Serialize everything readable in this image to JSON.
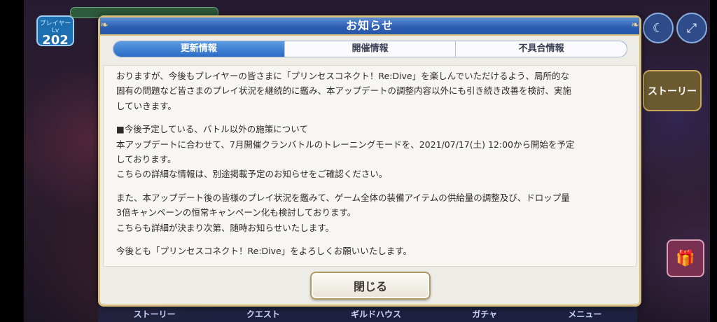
{
  "dialog": {
    "title": "お知らせ",
    "tabs": [
      {
        "label": "更新情報",
        "active": true
      },
      {
        "label": "開催情報",
        "active": false
      },
      {
        "label": "不具合情報",
        "active": false
      }
    ],
    "close_label": "閉じる",
    "paragraphs": [
      [
        "おりますが、今後もプレイヤーの皆さまに「プリンセスコネクト！Re:Dive」を楽しんでいただけるよう、局所的な",
        "固有の問題など皆さまのプレイ状況を継続的に鑑み、本アップデートの調整内容以外にも引き続き改善を検討、実施",
        "していきます。"
      ],
      [
        "■今後予定している、バトル以外の施策について",
        "本アップデートに合わせて、7月開催クランバトルのトレーニングモードを、2021/07/17(土) 12:00から開始を予定",
        "しております。",
        "こちらの詳細な情報は、別途掲載予定のお知らせをご確認ください。"
      ],
      [
        "また、本アップデート後の皆様のプレイ状況を鑑みて、ゲーム全体の装備アイテムの供給量の調整及び、ドロップ量",
        "3倍キャンペーンの恒常キャンペーン化も検討しております。",
        "こちらも詳細が決まり次第、随時お知らせいたします。"
      ],
      [
        "今後とも「プリンセスコネクト！Re:Dive」をよろしくお願いいたします。"
      ]
    ]
  },
  "background": {
    "player_level_label": "プレイヤーLv",
    "player_level": "202",
    "story_button": "ストーリー",
    "nav": [
      "ストーリー",
      "クエスト",
      "ギルドハウス",
      "ガチャ",
      "メニュー"
    ]
  },
  "colors": {
    "header_blue": "#2f5fb4",
    "active_tab": "#2c6cc6",
    "frame_gold": "#d8bf7c"
  }
}
